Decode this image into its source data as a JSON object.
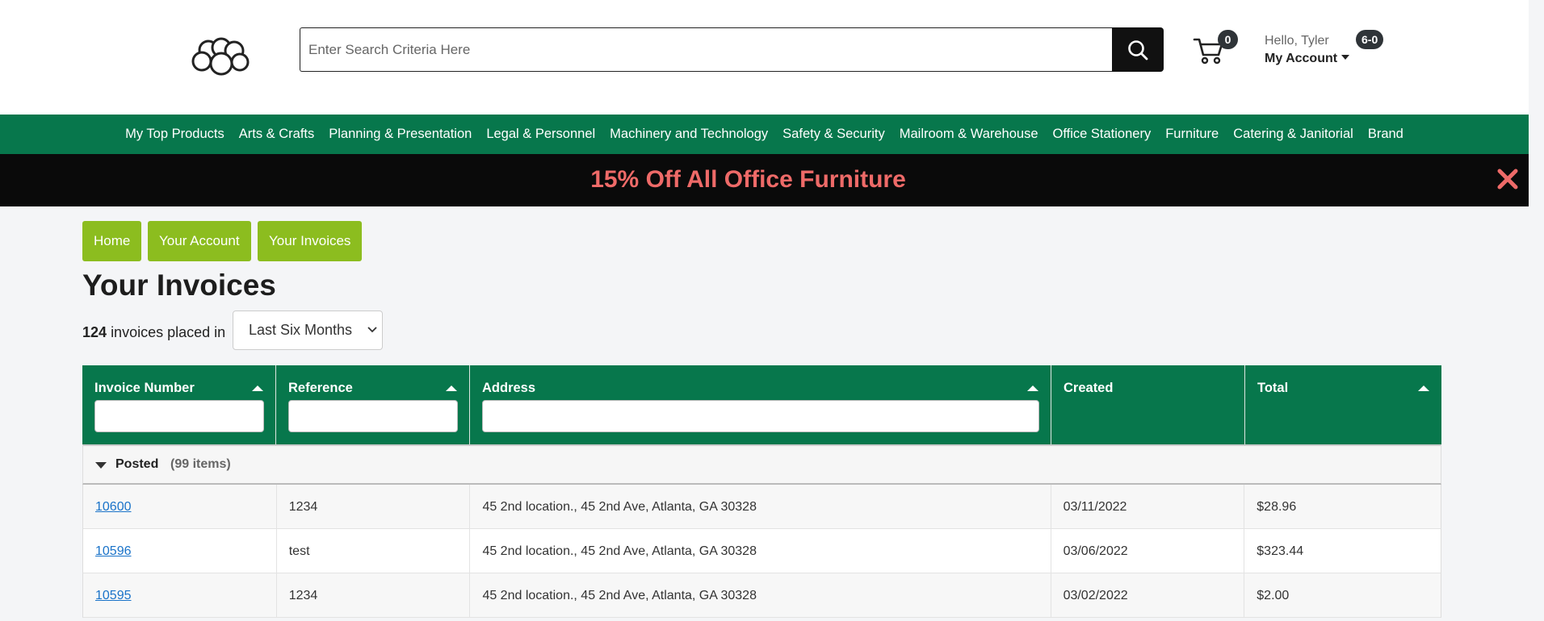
{
  "header": {
    "search_placeholder": "Enter Search Criteria Here",
    "cart_count": "0",
    "greeting": "Hello, Tyler",
    "account_label": "My Account",
    "account_badge": "6-0"
  },
  "nav": {
    "items": [
      "My Top Products",
      "Arts & Crafts",
      "Planning & Presentation",
      "Legal & Personnel",
      "Machinery and Technology",
      "Safety & Security",
      "Mailroom & Warehouse",
      "Office Stationery",
      "Furniture",
      "Catering & Janitorial",
      "Brand"
    ]
  },
  "promo": {
    "text": "15% Off All Office Furniture",
    "close_glyph": "✖"
  },
  "breadcrumb": [
    "Home",
    "Your Account",
    "Your Invoices"
  ],
  "page": {
    "title": "Your Invoices",
    "invoice_count": "124",
    "count_suffix": "invoices placed in",
    "period": "Last Six Months"
  },
  "table": {
    "columns": [
      "Invoice Number",
      "Reference",
      "Address",
      "Created",
      "Total"
    ],
    "group": {
      "label": "Posted",
      "count": "(99 items)"
    },
    "rows": [
      {
        "invoice": "10600",
        "reference": "1234",
        "address": "45 2nd location., 45 2nd Ave, Atlanta, GA 30328",
        "created": "03/11/2022",
        "total": "$28.96"
      },
      {
        "invoice": "10596",
        "reference": "test",
        "address": "45 2nd location., 45 2nd Ave, Atlanta, GA 30328",
        "created": "03/06/2022",
        "total": "$323.44"
      },
      {
        "invoice": "10595",
        "reference": "1234",
        "address": "45 2nd location., 45 2nd Ave, Atlanta, GA 30328",
        "created": "03/02/2022",
        "total": "$2.00"
      }
    ]
  },
  "colors": {
    "primary_green": "#07774c",
    "breadcrumb_green": "#8cbd1f",
    "promo_text": "#ee6a68",
    "link": "#1a73c9"
  },
  "icons": [
    "logo-clouds",
    "search-icon",
    "cart-icon",
    "close-icon",
    "sort-arrow-icon",
    "caret-down-icon"
  ]
}
